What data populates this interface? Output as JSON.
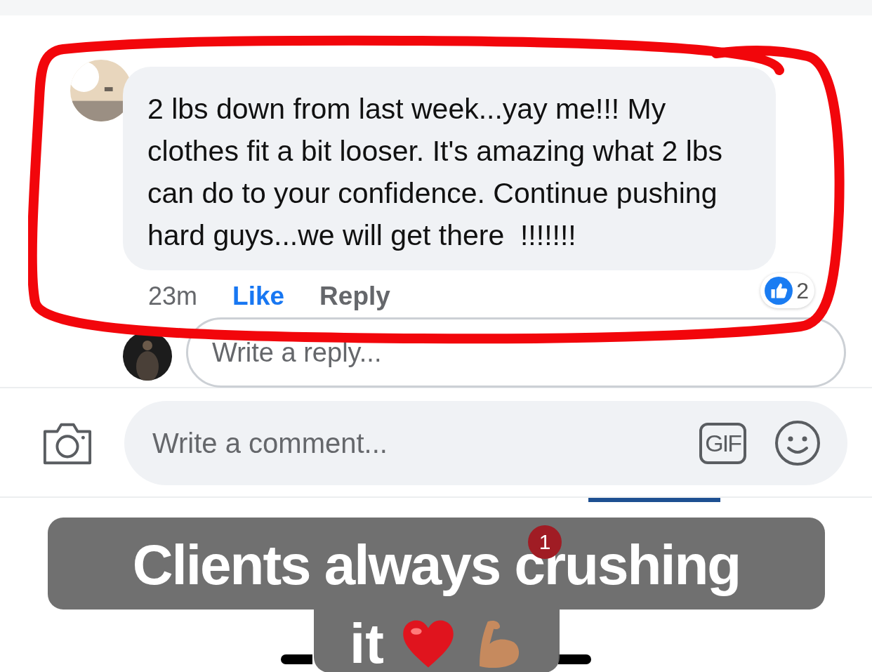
{
  "comment": {
    "text": "2 lbs down from last week...yay me!!! My clothes fit a bit looser. It's amazing what 2 lbs can do to your confidence. Continue pushing hard guys...we will get there  !!!!!!!",
    "time": "23m",
    "actions": [
      {
        "label": "Like",
        "selected": true
      },
      {
        "label": "Reply",
        "selected": false
      }
    ],
    "reaction_count": "2"
  },
  "reply_field": {
    "placeholder": "Write a reply..."
  },
  "comment_field": {
    "placeholder": "Write a comment...",
    "gif_label": "GIF"
  },
  "nav": {
    "badge": "1"
  },
  "caption": {
    "lines": [
      "Clients always crushing",
      "it"
    ]
  }
}
